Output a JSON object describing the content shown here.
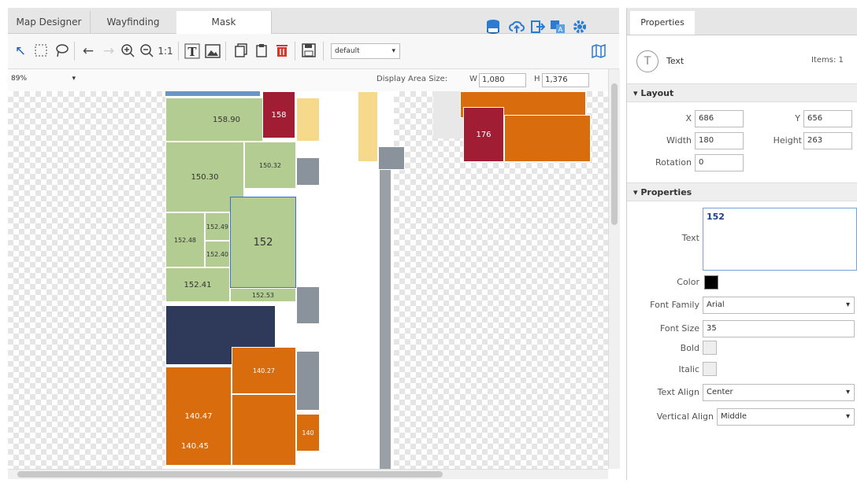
{
  "tabs": [
    {
      "label": "Map Designer",
      "active": false
    },
    {
      "label": "Wayfinding",
      "active": false
    },
    {
      "label": "Mask",
      "active": true
    }
  ],
  "toolbar": {
    "style_select": "default",
    "zoom_select": "89%",
    "display_area_label": "Display Area Size:",
    "w_label": "W",
    "w_value": "1,080",
    "h_label": "H",
    "h_value": "1,376"
  },
  "rooms": {
    "r15090": "158.90",
    "r158": "158",
    "r15030": "150.30",
    "r15032": "150.32",
    "r15240a": "152.49",
    "r15248": "152.48",
    "r15240b": "152.40",
    "r152": "152",
    "r15241": "152.41",
    "r15253": "152.53",
    "r176": "176",
    "r14047": "140.47",
    "r14045": "140.45",
    "r14027": "140.27",
    "r140": "140"
  },
  "panel": {
    "tab": "Properties",
    "element_type": "Text",
    "items_label": "Items: 1",
    "layout_header": "Layout",
    "x_label": "X",
    "x_value": "686",
    "y_label": "Y",
    "y_value": "656",
    "width_label": "Width",
    "width_value": "180",
    "height_label": "Height",
    "height_value": "263",
    "rotation_label": "Rotation",
    "rotation_value": "0",
    "properties_header": "Properties",
    "text_label": "Text",
    "text_value": "152",
    "color_label": "Color",
    "color_value": "#000000",
    "font_family_label": "Font Family",
    "font_family_value": "Arial",
    "font_size_label": "Font Size",
    "font_size_value": "35",
    "bold_label": "Bold",
    "italic_label": "Italic",
    "text_align_label": "Text Align",
    "text_align_value": "Center",
    "vertical_align_label": "Vertical Align",
    "vertical_align_value": "Middle"
  },
  "icons": [
    "pointer-add-icon",
    "marquee-select-icon",
    "lasso-icon",
    "undo-icon",
    "redo-icon",
    "zoom-in-icon",
    "zoom-out-icon",
    "actual-size-icon",
    "text-tool-icon",
    "image-tool-icon",
    "copy-icon",
    "paste-icon",
    "delete-icon",
    "save-icon",
    "map-book-icon",
    "database-icon",
    "upload-cloud-icon",
    "export-icon",
    "translate-icon",
    "gear-icon",
    "text-type-icon"
  ]
}
